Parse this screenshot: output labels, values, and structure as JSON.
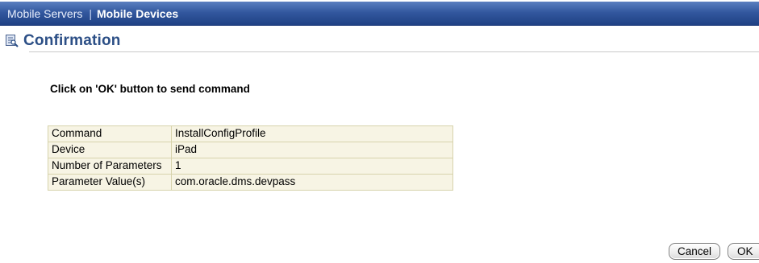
{
  "navbar": {
    "link_label": "Mobile Servers",
    "separator": "|",
    "current_label": "Mobile Devices"
  },
  "header": {
    "icon": "document-icon",
    "title": "Confirmation"
  },
  "instruction": "Click on 'OK' button to send command",
  "details": {
    "rows": [
      {
        "label": "Command",
        "value": "InstallConfigProfile"
      },
      {
        "label": "Device",
        "value": "iPad"
      },
      {
        "label": "Number of Parameters",
        "value": "1"
      },
      {
        "label": "Parameter Value(s)",
        "value": "com.oracle.dms.devpass"
      }
    ]
  },
  "buttons": {
    "cancel_label": "Cancel",
    "ok_label": "OK"
  },
  "colors": {
    "navbar_top": "#5b7fc0",
    "navbar_bottom": "#1f4184",
    "title": "#2c4f86",
    "table_bg": "#f7f4e4",
    "table_border": "#d7d3ac"
  }
}
